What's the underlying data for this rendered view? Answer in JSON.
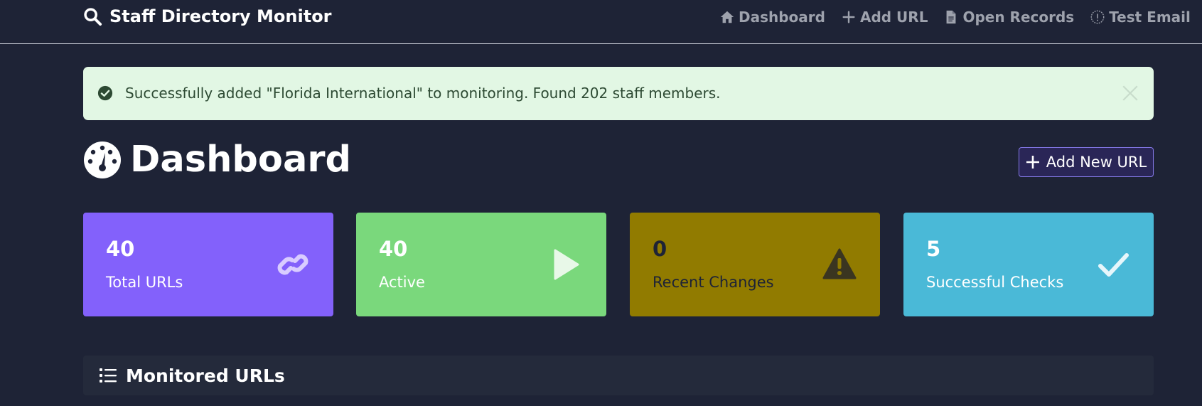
{
  "navbar": {
    "brand": "Staff Directory Monitor",
    "links": [
      {
        "label": "Dashboard",
        "icon": "home-icon"
      },
      {
        "label": "Add URL",
        "icon": "plus-icon"
      },
      {
        "label": "Open Records",
        "icon": "document-icon"
      },
      {
        "label": "Test Email",
        "icon": "info-circle-icon"
      }
    ]
  },
  "alert": {
    "message": "Successfully added \"Florida International\" to monitoring. Found 202 staff members.",
    "icon": "check-circle-icon",
    "close_icon": "close-icon"
  },
  "page": {
    "title": "Dashboard",
    "title_icon": "speedometer-icon",
    "add_button_label": "Add New URL"
  },
  "stats": [
    {
      "value": "40",
      "label": "Total URLs",
      "icon": "link-icon",
      "color": "#8361fb"
    },
    {
      "value": "40",
      "label": "Active",
      "icon": "play-icon",
      "color": "#7ad87c"
    },
    {
      "value": "0",
      "label": "Recent Changes",
      "icon": "warning-icon",
      "color": "#917b00"
    },
    {
      "value": "5",
      "label": "Successful Checks",
      "icon": "checkmark-icon",
      "color": "#4ab9d7"
    }
  ],
  "section": {
    "title": "Monitored URLs",
    "icon": "list-icon"
  }
}
